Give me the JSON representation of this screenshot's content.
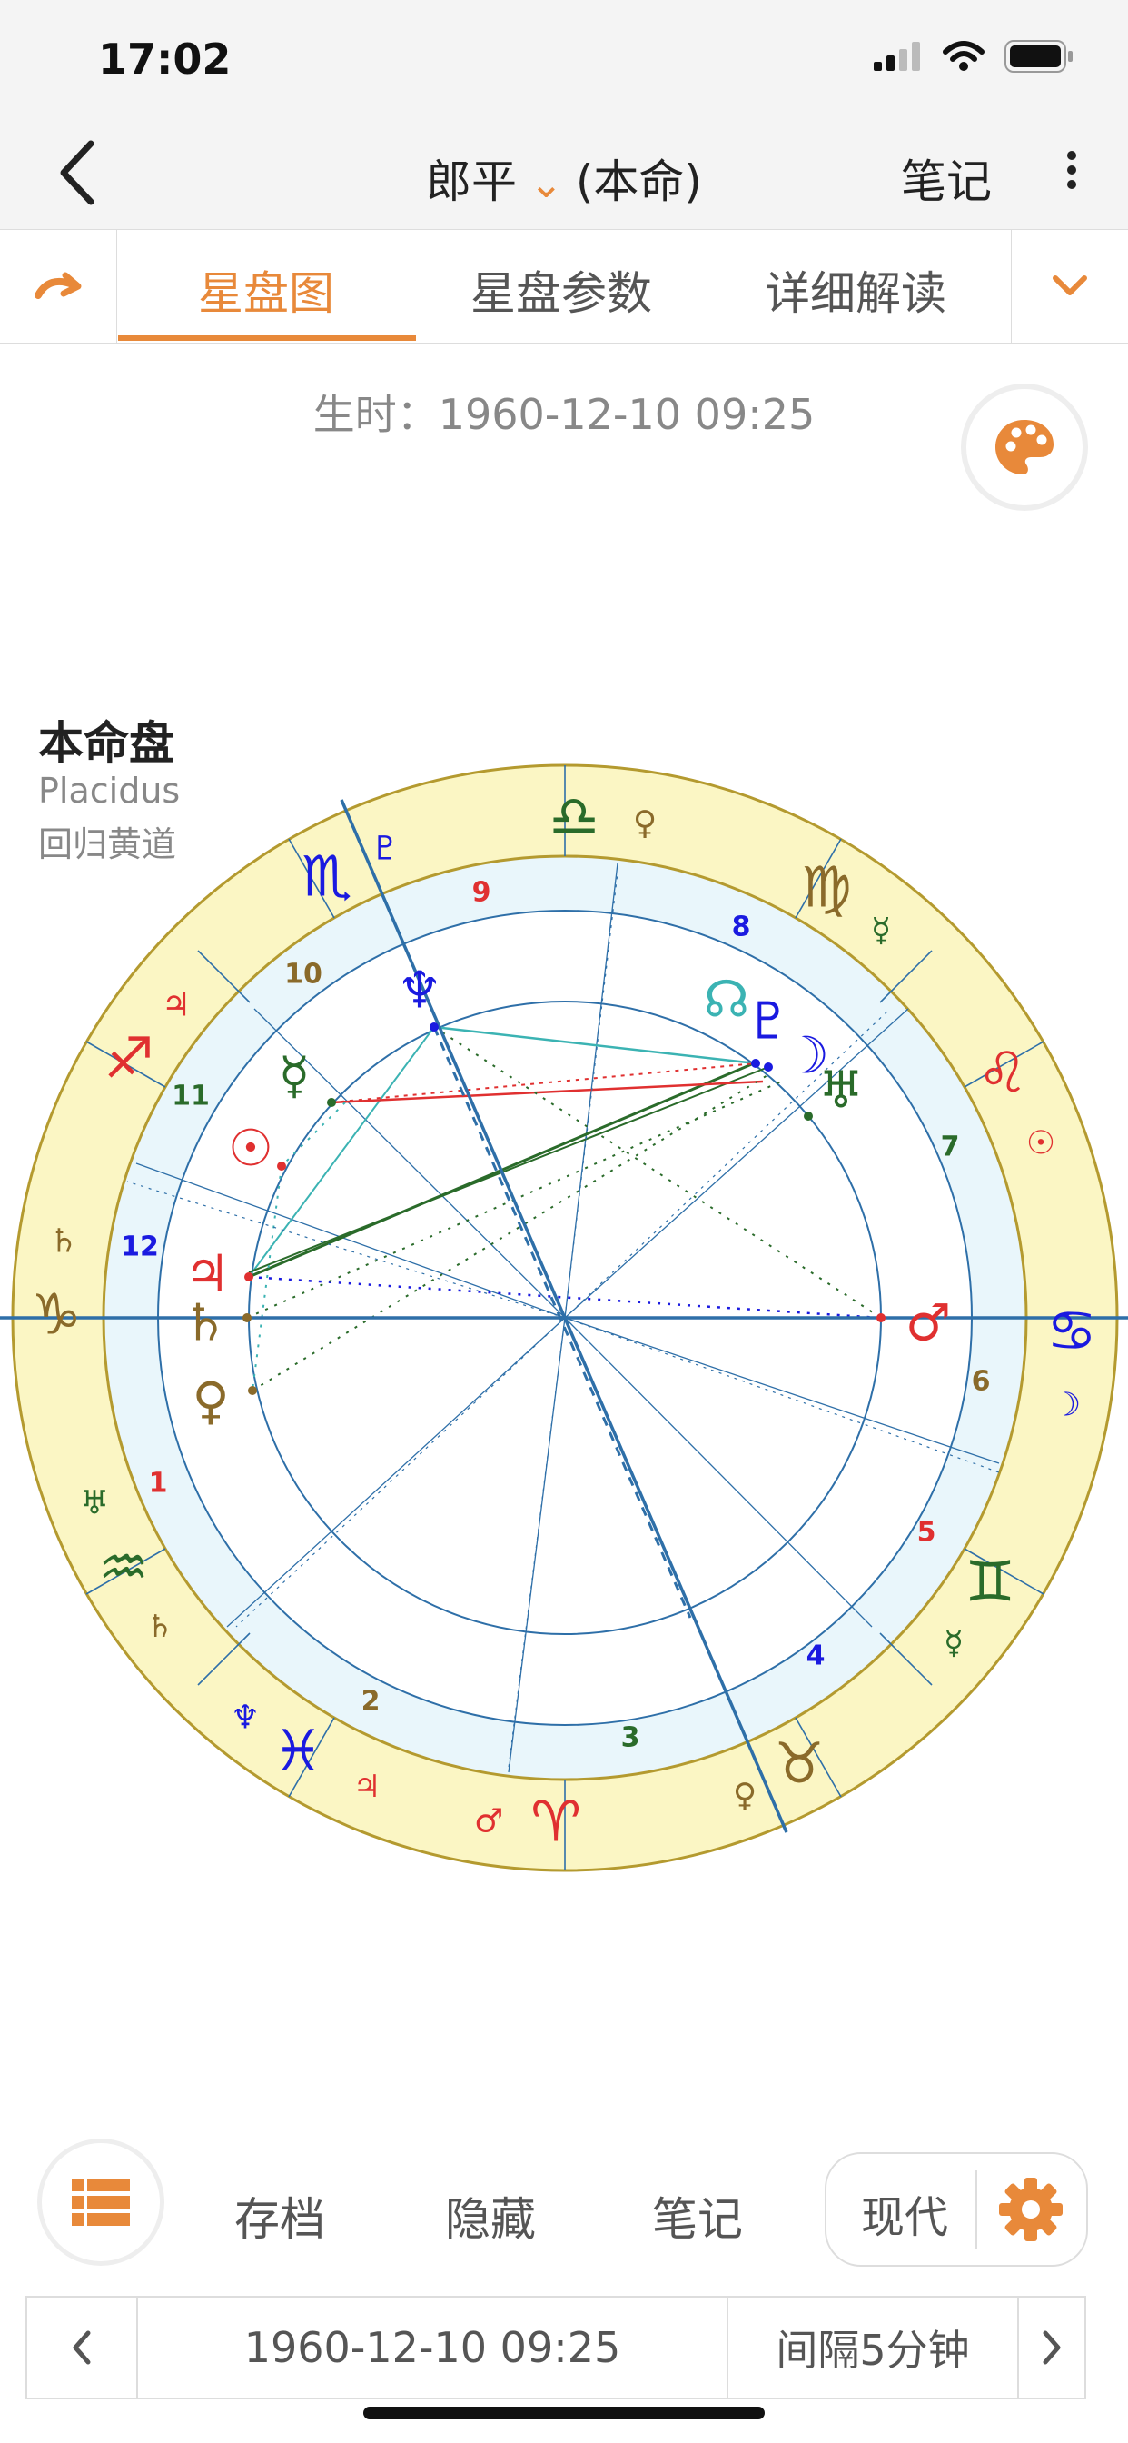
{
  "status_bar": {
    "time": "17:02"
  },
  "nav": {
    "title_name": "郎平",
    "title_type": "(本命)",
    "notes": "笔记"
  },
  "tabs": [
    {
      "label": "星盘图",
      "active": true
    },
    {
      "label": "星盘参数",
      "active": false
    },
    {
      "label": "详细解读",
      "active": false
    }
  ],
  "birth_info": "生时：1960-12-10 09:25",
  "chart_title": "本命盘",
  "house_system": "Placidus",
  "zodiac": "回归黄道",
  "colors": {
    "accent": "#e8893a",
    "ring": "#fbf6c4",
    "inner_ring": "#e9f6fb",
    "axis": "#2e6fa8"
  },
  "chart_data": {
    "type": "astrology_wheel",
    "house_numbers": [
      "1",
      "2",
      "3",
      "4",
      "5",
      "6",
      "7",
      "8",
      "9",
      "10",
      "11",
      "12"
    ],
    "signs": [
      "♑",
      "♒",
      "♓",
      "♈",
      "♉",
      "♊",
      "♋",
      "♌",
      "♍",
      "♎",
      "♏",
      "♐"
    ],
    "sign_rulers": [
      "♄",
      "♅",
      "♆",
      "♂",
      "♀",
      "☿",
      "☽",
      "☉",
      "☿",
      "♀",
      "♇",
      "♃"
    ],
    "sign_coruler": [
      "♄",
      "♄",
      "♃"
    ],
    "planets": [
      "♃",
      "♄",
      "♀",
      "☉",
      "☿",
      "♆",
      "☊",
      "♇",
      "☽",
      "♅",
      "♂"
    ]
  },
  "toolbar": {
    "save": "存档",
    "hide": "隐藏",
    "notes": "笔记",
    "mode": "现代"
  },
  "datebar": {
    "date": "1960-12-10 09:25",
    "interval": "间隔5分钟"
  }
}
